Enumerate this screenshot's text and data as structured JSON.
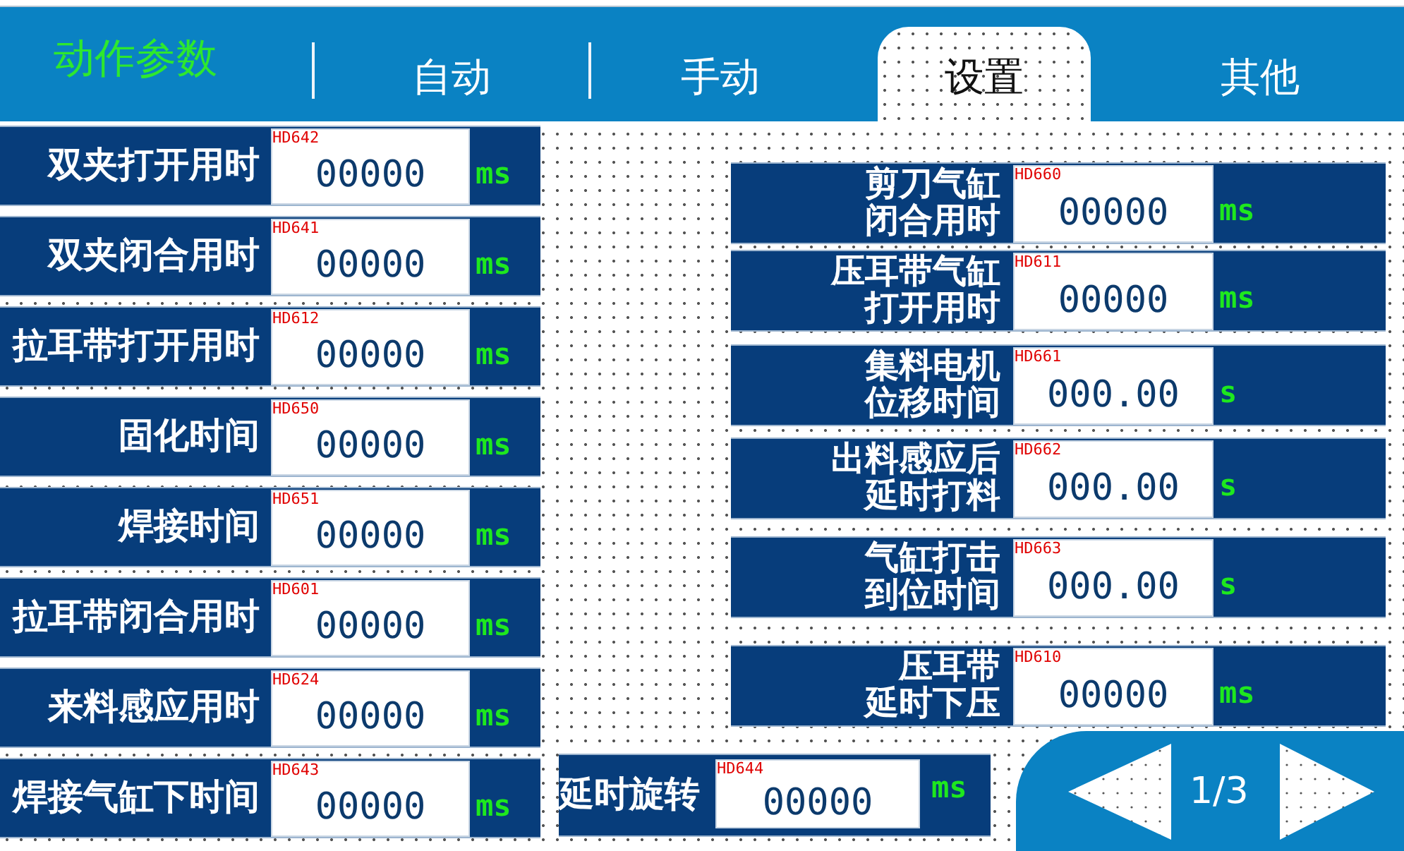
{
  "title": "动作参数",
  "tabs": [
    {
      "label": "自动",
      "selected": false
    },
    {
      "label": "手动",
      "selected": false
    },
    {
      "label": "设置",
      "selected": true
    },
    {
      "label": "其他",
      "selected": false
    }
  ],
  "left_params": [
    {
      "label": "双夹打开用时",
      "register": "HD642",
      "value": "00000",
      "unit": "ms"
    },
    {
      "label": "双夹闭合用时",
      "register": "HD641",
      "value": "00000",
      "unit": "ms"
    },
    {
      "label": "拉耳带打开用时",
      "register": "HD612",
      "value": "00000",
      "unit": "ms"
    },
    {
      "label": "固化时间",
      "register": "HD650",
      "value": "00000",
      "unit": "ms"
    },
    {
      "label": "焊接时间",
      "register": "HD651",
      "value": "00000",
      "unit": "ms"
    },
    {
      "label": "拉耳带闭合用时",
      "register": "HD601",
      "value": "00000",
      "unit": "ms"
    },
    {
      "label": "来料感应用时",
      "register": "HD624",
      "value": "00000",
      "unit": "ms"
    },
    {
      "label": "焊接气缸下时间",
      "register": "HD643",
      "value": "00000",
      "unit": "ms"
    }
  ],
  "right_params": [
    {
      "label_lines": [
        "剪刀气缸",
        "闭合用时"
      ],
      "register": "HD660",
      "value": "00000",
      "unit": "ms"
    },
    {
      "label_lines": [
        "压耳带气缸",
        "打开用时"
      ],
      "register": "HD611",
      "value": "00000",
      "unit": "ms"
    },
    {
      "label_lines": [
        "集料电机",
        "位移时间"
      ],
      "register": "HD661",
      "value": "000.00",
      "unit": "s"
    },
    {
      "label_lines": [
        "出料感应后",
        "延时打料"
      ],
      "register": "HD662",
      "value": "000.00",
      "unit": "s"
    },
    {
      "label_lines": [
        "气缸打击",
        "到位时间"
      ],
      "register": "HD663",
      "value": "000.00",
      "unit": "s"
    },
    {
      "label_lines": [
        "压耳带",
        "延时下压"
      ],
      "register": "HD610",
      "value": "00000",
      "unit": "ms"
    }
  ],
  "bottom_param": {
    "label": "延时旋转",
    "register": "HD644",
    "value": "00000",
    "unit": "ms"
  },
  "pager": {
    "page": "1/3"
  }
}
